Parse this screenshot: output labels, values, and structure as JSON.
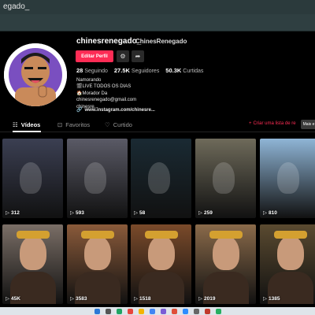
{
  "browser": {
    "tab_title": "egado_"
  },
  "profile": {
    "username": "chinesrenegado_",
    "nickname": "ChinesRenegado",
    "edit_label": "Editar Perfil",
    "stats": [
      {
        "value": "28",
        "label": "Seguindo"
      },
      {
        "value": "27.5K",
        "label": "Seguidores"
      },
      {
        "value": "50.3K",
        "label": "Curtidas"
      }
    ],
    "bio": [
      "Namorando",
      "🎬LIVE TODOS OS DIAS",
      "🏠Morador Da",
      "chinesrenegado@gmail.com",
      "chinesre..."
    ],
    "link": "www.instagram.com/chinesre..."
  },
  "tabs": [
    {
      "label": "Vídeos",
      "icon": "grid-icon"
    },
    {
      "label": "Favoritos",
      "icon": "bookmark-icon"
    },
    {
      "label": "Curtido",
      "icon": "heart-outline-icon"
    }
  ],
  "playlist_label": "Criar uma lista de re",
  "tooltip": "Mais e",
  "videos": [
    {
      "views": "312",
      "bg": "#3b3f52"
    },
    {
      "views": "593",
      "bg": "#5a5a66"
    },
    {
      "views": "58",
      "bg": "#1a2a33"
    },
    {
      "views": "259",
      "bg": "#6e6a5a"
    },
    {
      "views": "810",
      "bg": "#8fb5d6"
    },
    {
      "views": "45K",
      "bg": "#7a6e66"
    },
    {
      "views": "3583",
      "bg": "#8a5a3a"
    },
    {
      "views": "1518",
      "bg": "#7a4a2a"
    },
    {
      "views": "2019",
      "bg": "#8a6a4a"
    },
    {
      "views": "1385",
      "bg": "#5a4a30"
    }
  ]
}
